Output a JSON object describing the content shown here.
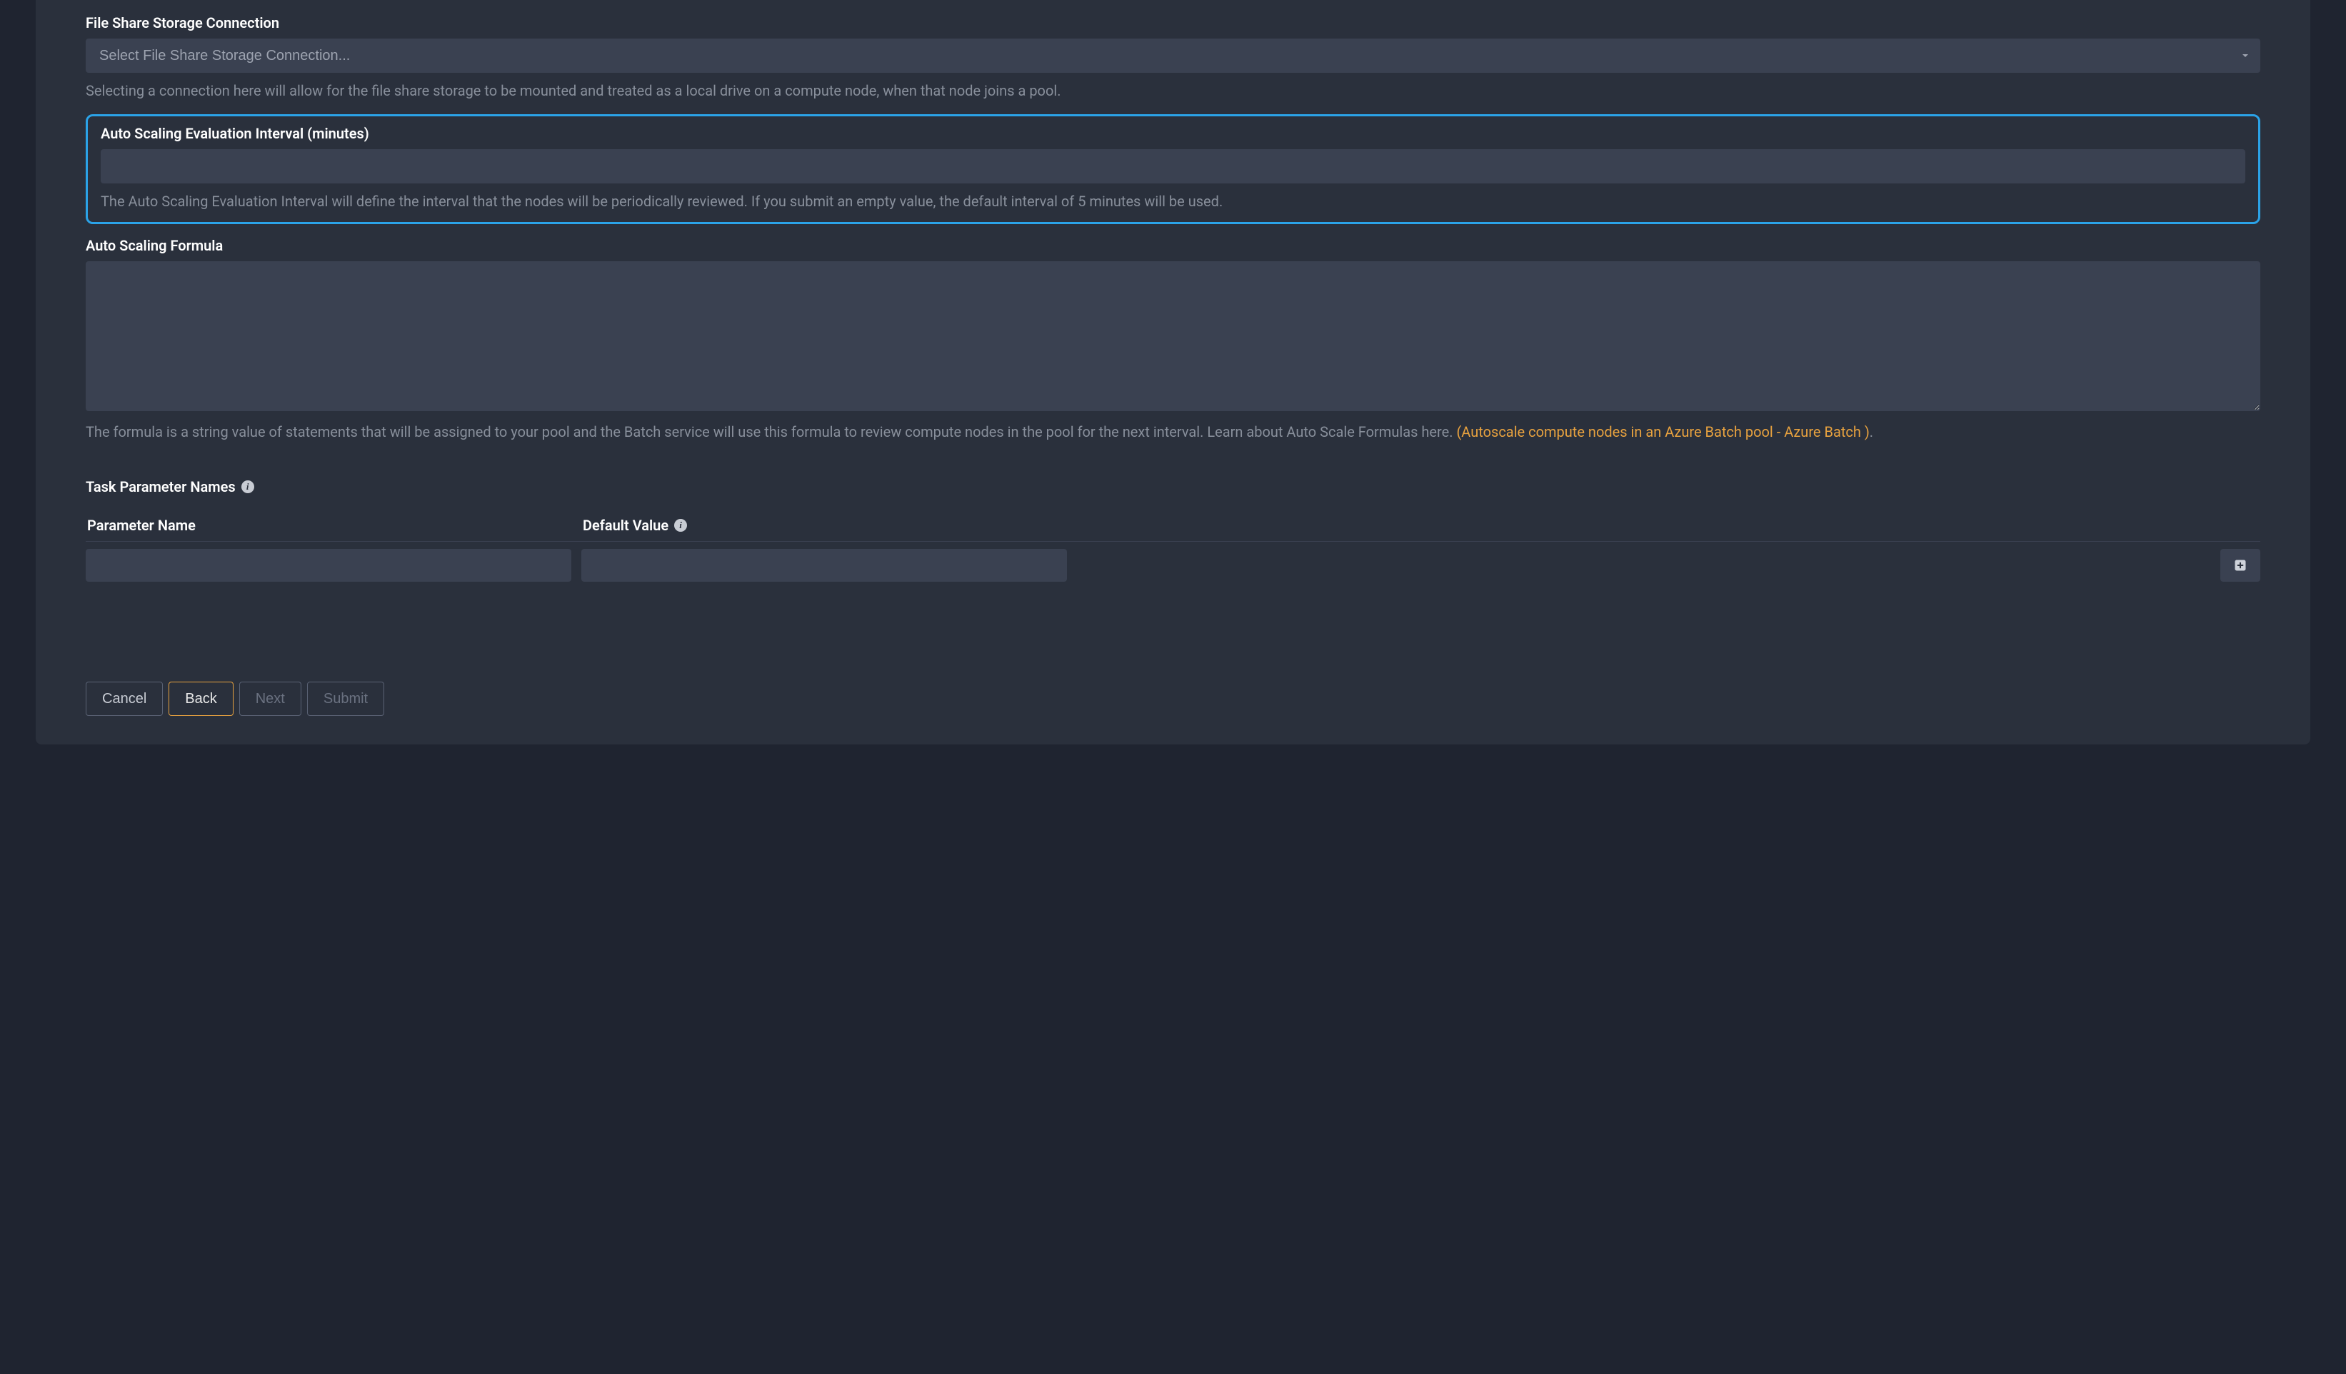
{
  "fields": {
    "fileShare": {
      "label": "File Share Storage Connection",
      "placeholder": "Select File Share Storage Connection...",
      "help": "Selecting a connection here will allow for the file share storage to be mounted and treated as a local drive on a compute node, when that node joins a pool.",
      "value": ""
    },
    "autoScaleInterval": {
      "label": "Auto Scaling Evaluation Interval (minutes)",
      "help": "The Auto Scaling Evaluation Interval will define the interval that the nodes will be periodically reviewed. If you submit an empty value, the default interval of 5 minutes will be used.",
      "value": ""
    },
    "autoScaleFormula": {
      "label": "Auto Scaling Formula",
      "helpPrefix": "The formula is a string value of statements that will be assigned to your pool and the Batch service will use this formula to review compute nodes in the pool for the next interval. Learn about Auto Scale Formulas here. ",
      "helpLink": "(Autoscale compute nodes in an Azure Batch pool - Azure Batch )",
      "helpSuffix": ".",
      "value": ""
    }
  },
  "taskParams": {
    "sectionLabel": "Task Parameter Names",
    "headers": {
      "name": "Parameter Name",
      "default": "Default Value"
    },
    "rows": [
      {
        "name": "",
        "default": ""
      }
    ]
  },
  "buttons": {
    "cancel": "Cancel",
    "back": "Back",
    "next": "Next",
    "submit": "Submit"
  }
}
